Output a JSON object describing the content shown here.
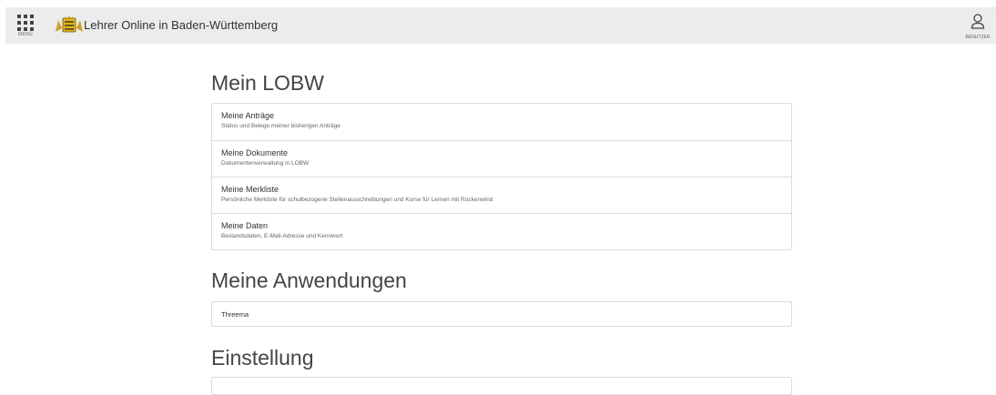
{
  "header": {
    "menu_label": "MENÜ",
    "title": "Lehrer Online in Baden-Württemberg",
    "user_label": "BENUTZER"
  },
  "sections": {
    "mein_lobw": {
      "title": "Mein LOBW",
      "items": [
        {
          "title": "Meine Anträge",
          "desc": "Status und Belege meiner bisherigen Anträge"
        },
        {
          "title": "Meine Dokumente",
          "desc": "Dokumentenverwaltung in LOBW"
        },
        {
          "title": "Meine Merkliste",
          "desc": "Persönliche Merkliste für schulbezogene Stellenausschreibungen und Kurse für Lernen mit Rückenwind"
        },
        {
          "title": "Meine Daten",
          "desc": "Bestandsdaten, E-Mail-Adresse und Kennwort"
        }
      ]
    },
    "anwendungen": {
      "title": "Meine Anwendungen",
      "items": [
        {
          "title": "Threema"
        }
      ]
    },
    "einstellung": {
      "title": "Einstellung"
    }
  },
  "colors": {
    "header_bg": "#ececec",
    "border": "#dcdcdc",
    "logo_gold": "#d4a017"
  },
  "icons": {
    "menu": "grid-icon",
    "logo": "coat-of-arms-logo",
    "user": "user-icon"
  }
}
